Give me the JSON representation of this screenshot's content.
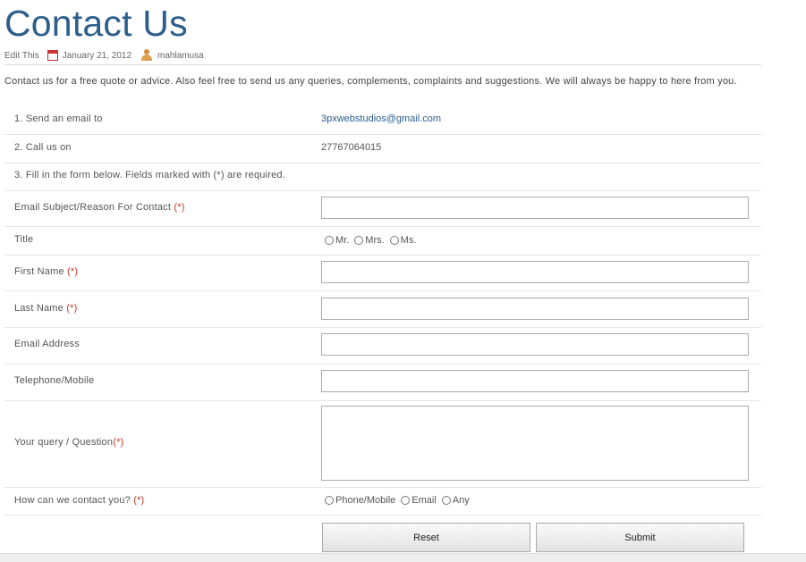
{
  "page": {
    "title": "Contact Us",
    "meta": {
      "edit": "Edit This",
      "date": "January 21, 2012",
      "author": "mahlamusa"
    },
    "intro": "Contact us for a free quote or advice. Also feel free to send us any queries, complements, complaints and suggestions. We will always be happy to here from you."
  },
  "info": {
    "email_label": "1. Send an email to",
    "email_value": "3pxwebstudios@gmail.com",
    "phone_label": "2. Call us on",
    "phone_value": "27767064015",
    "form_note": "3. Fill in the form below. Fields marked with (*) are required."
  },
  "form": {
    "req": "(*)",
    "subject_label": "Email Subject/Reason For Contact ",
    "title_label": "Title",
    "title_options": [
      "Mr.",
      "Mrs.",
      "Ms."
    ],
    "first_name_label": "First Name ",
    "last_name_label": "Last Name ",
    "email_label": "Email Address",
    "telephone_label": "Telephone/Mobile",
    "query_label": "Your query / Question",
    "contact_label": "How can we contact you? ",
    "contact_options": [
      "Phone/Mobile",
      "Email",
      "Any"
    ],
    "reset": "Reset",
    "submit": "Submit"
  }
}
